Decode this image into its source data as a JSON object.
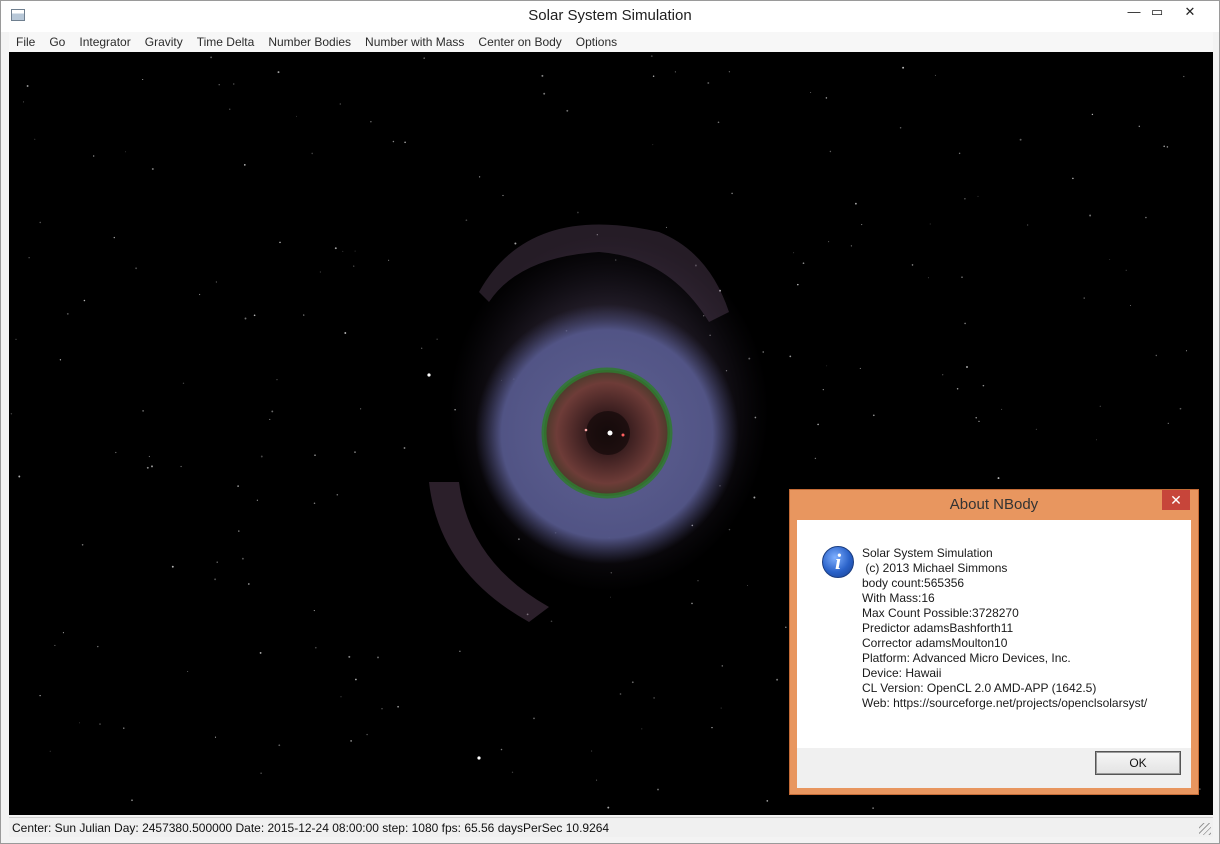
{
  "window": {
    "title": "Solar System Simulation"
  },
  "menu": [
    "File",
    "Go",
    "Integrator",
    "Gravity",
    "Time Delta",
    "Number Bodies",
    "Number with Mass",
    "Center on Body",
    "Options"
  ],
  "status_bar": {
    "text": "Center: Sun Julian Day: 2457380.500000 Date: 2015-12-24 08:00:00 step: 1080 fps: 65.56 daysPerSec 10.9264"
  },
  "dialog": {
    "title": "About NBody",
    "icon": "info-icon",
    "lines": [
      "Solar System Simulation",
      " (c) 2013 Michael Simmons",
      "body count:565356",
      "With Mass:16",
      "Max Count Possible:3728270",
      "Predictor adamsBashforth11",
      "Corrector adamsMoulton10",
      "Platform: Advanced Micro Devices, Inc.",
      "Device: Hawaii",
      "CL Version: OpenCL 2.0 AMD-APP (1642.5)",
      "Web: https://sourceforge.net/projects/openclsolarsyst/"
    ],
    "ok_label": "OK"
  },
  "colors": {
    "space": "#000000",
    "outer_disk": "#5d5f8f",
    "asteroid_ring": "#2f7a2f",
    "inner_disk": "#6a3a3a",
    "dialog_frame": "#e8965f",
    "close_button": "#c7453a"
  }
}
